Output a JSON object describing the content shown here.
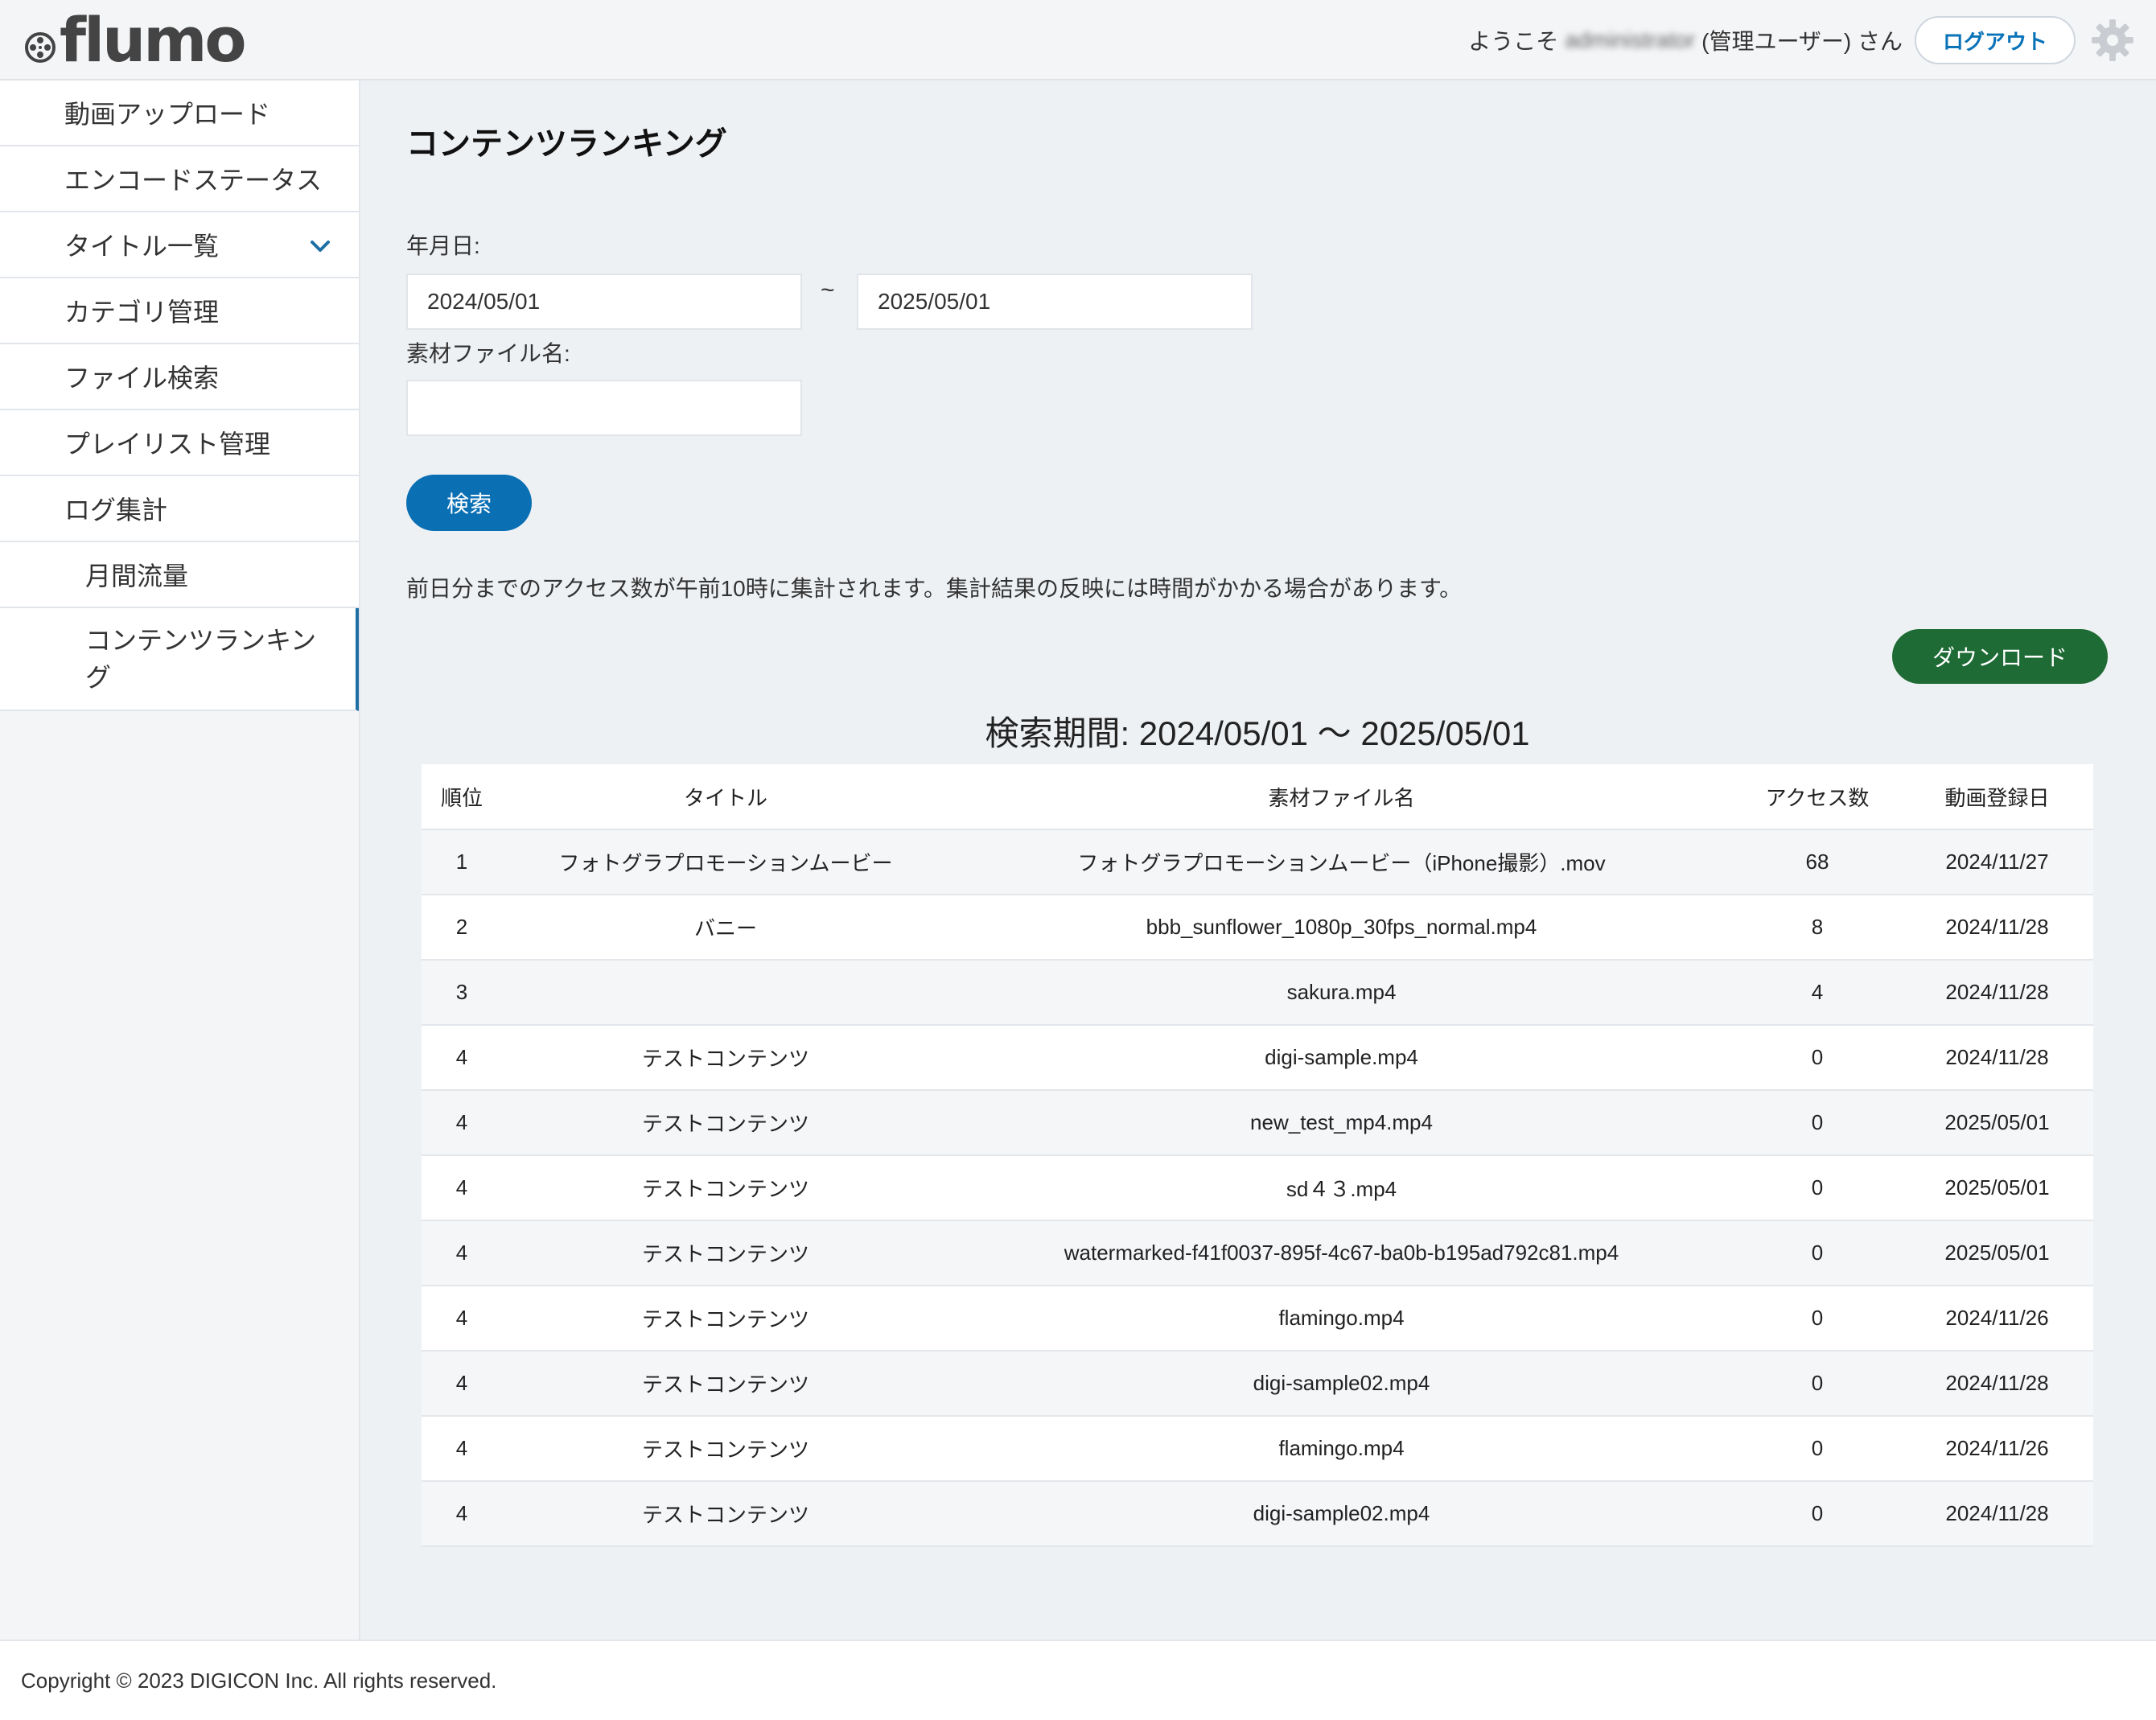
{
  "header": {
    "logo_text": "flumo",
    "welcome_prefix": "ようこそ",
    "username": "administrator",
    "welcome_suffix": "(管理ユーザー) さん",
    "logout_label": "ログアウト"
  },
  "sidebar": {
    "items": [
      {
        "label": "動画アップロード"
      },
      {
        "label": "エンコードステータス"
      },
      {
        "label": "タイトル一覧"
      },
      {
        "label": "カテゴリ管理"
      },
      {
        "label": "ファイル検索"
      },
      {
        "label": "プレイリスト管理"
      },
      {
        "label": "ログ集計"
      },
      {
        "label": "月間流量"
      },
      {
        "label": "コンテンツランキング"
      }
    ]
  },
  "main": {
    "title": "コンテンツランキング",
    "date_label": "年月日:",
    "date_from": "2024/05/01",
    "tilde": "~",
    "date_to": "2025/05/01",
    "filename_label": "素材ファイル名:",
    "filename_value": "",
    "search_label": "検索",
    "notice": "前日分までのアクセス数が午前10時に集計されます。集計結果の反映には時間がかかる場合があります。",
    "download_label": "ダウンロード",
    "period_text": "検索期間: 2024/05/01 〜 2025/05/01"
  },
  "table": {
    "headers": [
      "順位",
      "タイトル",
      "素材ファイル名",
      "アクセス数",
      "動画登録日"
    ],
    "rows": [
      [
        "1",
        "フォトグラプロモーションムービー",
        "フォトグラプロモーションムービー（iPhone撮影）.mov",
        "68",
        "2024/11/27"
      ],
      [
        "2",
        "バニー",
        "bbb_sunflower_1080p_30fps_normal.mp4",
        "8",
        "2024/11/28"
      ],
      [
        "3",
        "",
        "sakura.mp4",
        "4",
        "2024/11/28"
      ],
      [
        "4",
        "テストコンテンツ",
        "digi-sample.mp4",
        "0",
        "2024/11/28"
      ],
      [
        "4",
        "テストコンテンツ",
        "new_test_mp4.mp4",
        "0",
        "2025/05/01"
      ],
      [
        "4",
        "テストコンテンツ",
        "sd４３.mp4",
        "0",
        "2025/05/01"
      ],
      [
        "4",
        "テストコンテンツ",
        "watermarked-f41f0037-895f-4c67-ba0b-b195ad792c81.mp4",
        "0",
        "2025/05/01"
      ],
      [
        "4",
        "テストコンテンツ",
        "flamingo.mp4",
        "0",
        "2024/11/26"
      ],
      [
        "4",
        "テストコンテンツ",
        "digi-sample02.mp4",
        "0",
        "2024/11/28"
      ],
      [
        "4",
        "テストコンテンツ",
        "flamingo.mp4",
        "0",
        "2024/11/26"
      ],
      [
        "4",
        "テストコンテンツ",
        "digi-sample02.mp4",
        "0",
        "2024/11/28"
      ]
    ]
  },
  "footer": {
    "copyright": "Copyright © 2023 DIGICON Inc. All rights reserved."
  },
  "colors": {
    "primary": "#0b6fb4",
    "download": "#1e6b35",
    "active_border": "#1d6fa5"
  }
}
